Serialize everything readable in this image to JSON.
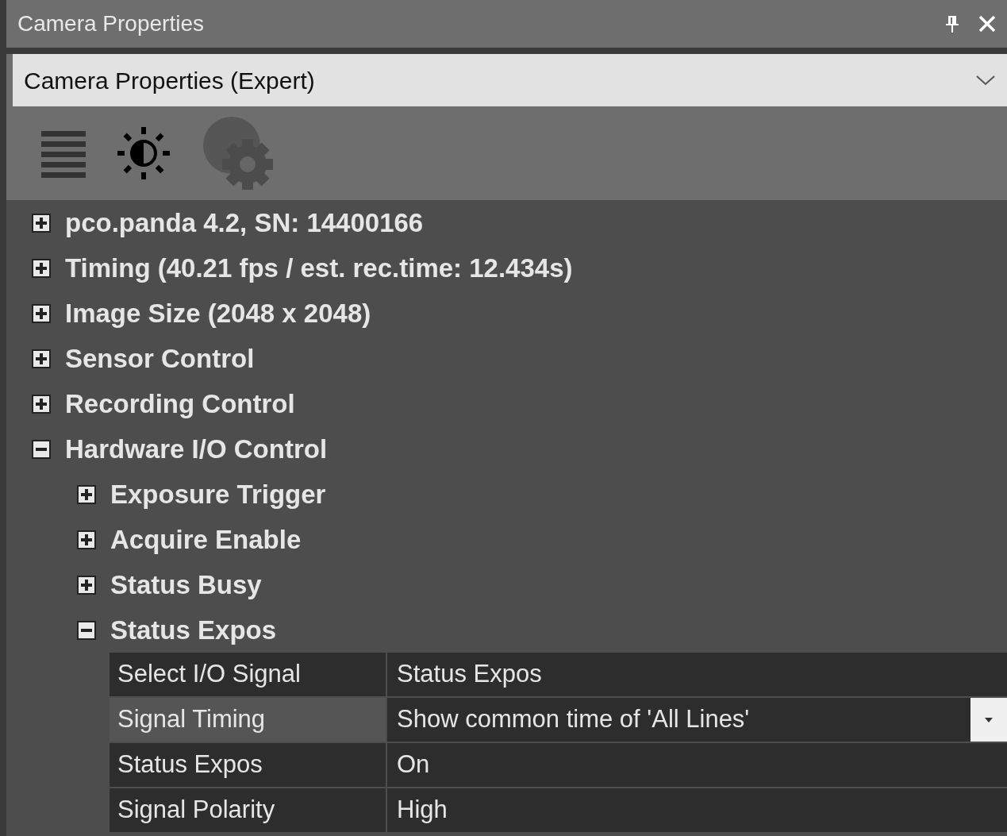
{
  "window": {
    "title": "Camera Properties"
  },
  "view_select": {
    "value": "Camera Properties (Expert)"
  },
  "toolbar": [
    {
      "kind": "list",
      "disabled": false
    },
    {
      "kind": "brightness",
      "disabled": false
    },
    {
      "kind": "settings",
      "disabled": true
    }
  ],
  "tree": [
    {
      "label": "pco.panda 4.2, SN: 14400166",
      "expanded": false
    },
    {
      "label": "Timing (40.21 fps / est. rec.time: 12.434s)",
      "expanded": false
    },
    {
      "label": "Image Size (2048 x 2048)",
      "expanded": false
    },
    {
      "label": "Sensor Control",
      "expanded": false
    },
    {
      "label": "Recording Control",
      "expanded": false
    },
    {
      "label": "Hardware I/O Control",
      "expanded": true,
      "children": [
        {
          "label": "Exposure Trigger",
          "expanded": false
        },
        {
          "label": "Acquire Enable",
          "expanded": false
        },
        {
          "label": "Status Busy",
          "expanded": false
        },
        {
          "label": "Status Expos",
          "expanded": true,
          "properties": [
            {
              "name": "Select I/O Signal",
              "value": "Status Expos",
              "kind": "text",
              "selected": false
            },
            {
              "name": "Signal Timing",
              "value": "Show common time of 'All Lines'",
              "kind": "dropdown",
              "selected": true
            },
            {
              "name": "Status Expos",
              "value": "On",
              "kind": "text",
              "selected": false
            },
            {
              "name": "Signal Polarity",
              "value": "High",
              "kind": "text",
              "selected": false
            }
          ]
        }
      ]
    }
  ]
}
